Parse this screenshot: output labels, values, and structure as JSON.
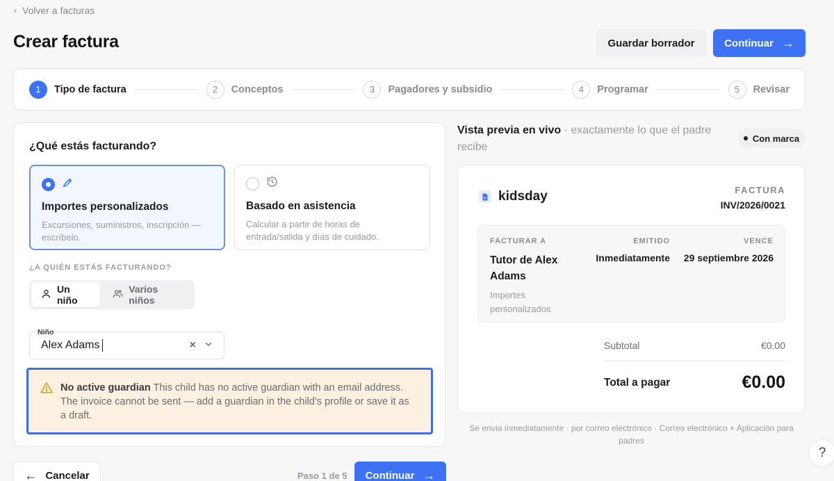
{
  "nav": {
    "back_label": "Volver a facturas"
  },
  "header": {
    "title": "Crear factura",
    "save_draft": "Guardar borrador",
    "continue": "Continuar"
  },
  "stepper": {
    "steps": [
      {
        "num": "1",
        "label": "Tipo de factura",
        "active": true
      },
      {
        "num": "2",
        "label": "Conceptos",
        "active": false
      },
      {
        "num": "3",
        "label": "Pagadores y subsidio",
        "active": false
      },
      {
        "num": "4",
        "label": "Programar",
        "active": false
      },
      {
        "num": "5",
        "label": "Revisar",
        "active": false
      }
    ]
  },
  "form": {
    "question": "¿Qué estás facturando?",
    "options": [
      {
        "title": "Importes personalizados",
        "description": "Excursiones, suministros, inscripción — escríbelo.",
        "selected": true,
        "icon": "pencil-icon"
      },
      {
        "title": "Basado en asistencia",
        "description": "Calcular a partir de horas de entrada/salida y días de cuidado.",
        "selected": false,
        "icon": "clock-history-icon"
      }
    ],
    "who_label": "¿A quién estás facturando?",
    "recipient_modes": [
      {
        "label": "Un niño",
        "active": true,
        "icon": "user-icon"
      },
      {
        "label": "Varios niños",
        "active": false,
        "icon": "users-icon"
      }
    ],
    "child_field": {
      "label": "Niño",
      "value": "Alex Adams"
    },
    "warning": {
      "title": "No active guardian",
      "message": "This child has no active guardian with an email address. The invoice cannot be sent — add a guardian in the child's profile or save it as a draft."
    }
  },
  "preview": {
    "heading": "Vista previa en vivo",
    "subheading": "· exactamente lo que el padre recibe",
    "brand_badge": "Con marca",
    "invoice": {
      "brand": "kidsday",
      "kind": "FACTURA",
      "number": "INV/2026/0021",
      "bill_to_label": "Facturar a",
      "bill_to_name": "Tutor de Alex Adams",
      "bill_to_type": "Importes personalizados",
      "issued_label": "Emitido",
      "issued_value": "Inmediatamente",
      "due_label": "Vence",
      "due_value": "29 septiembre 2026",
      "subtotal_label": "Subtotal",
      "subtotal_value": "€0.00",
      "total_label": "Total a pagar",
      "total_value": "€0.00"
    },
    "send_note": "Se envía inmediatamente · por correo electrónico · Correo electrónico + Aplicación para padres"
  },
  "footer": {
    "cancel": "Cancelar",
    "step_counter": "Paso 1 de 5",
    "continue": "Continuar"
  },
  "help": {
    "label": "?"
  },
  "colors": {
    "accent": "#3d72f5",
    "warning_bg": "#fcf1e0",
    "warning_icon": "#d99a1e"
  }
}
